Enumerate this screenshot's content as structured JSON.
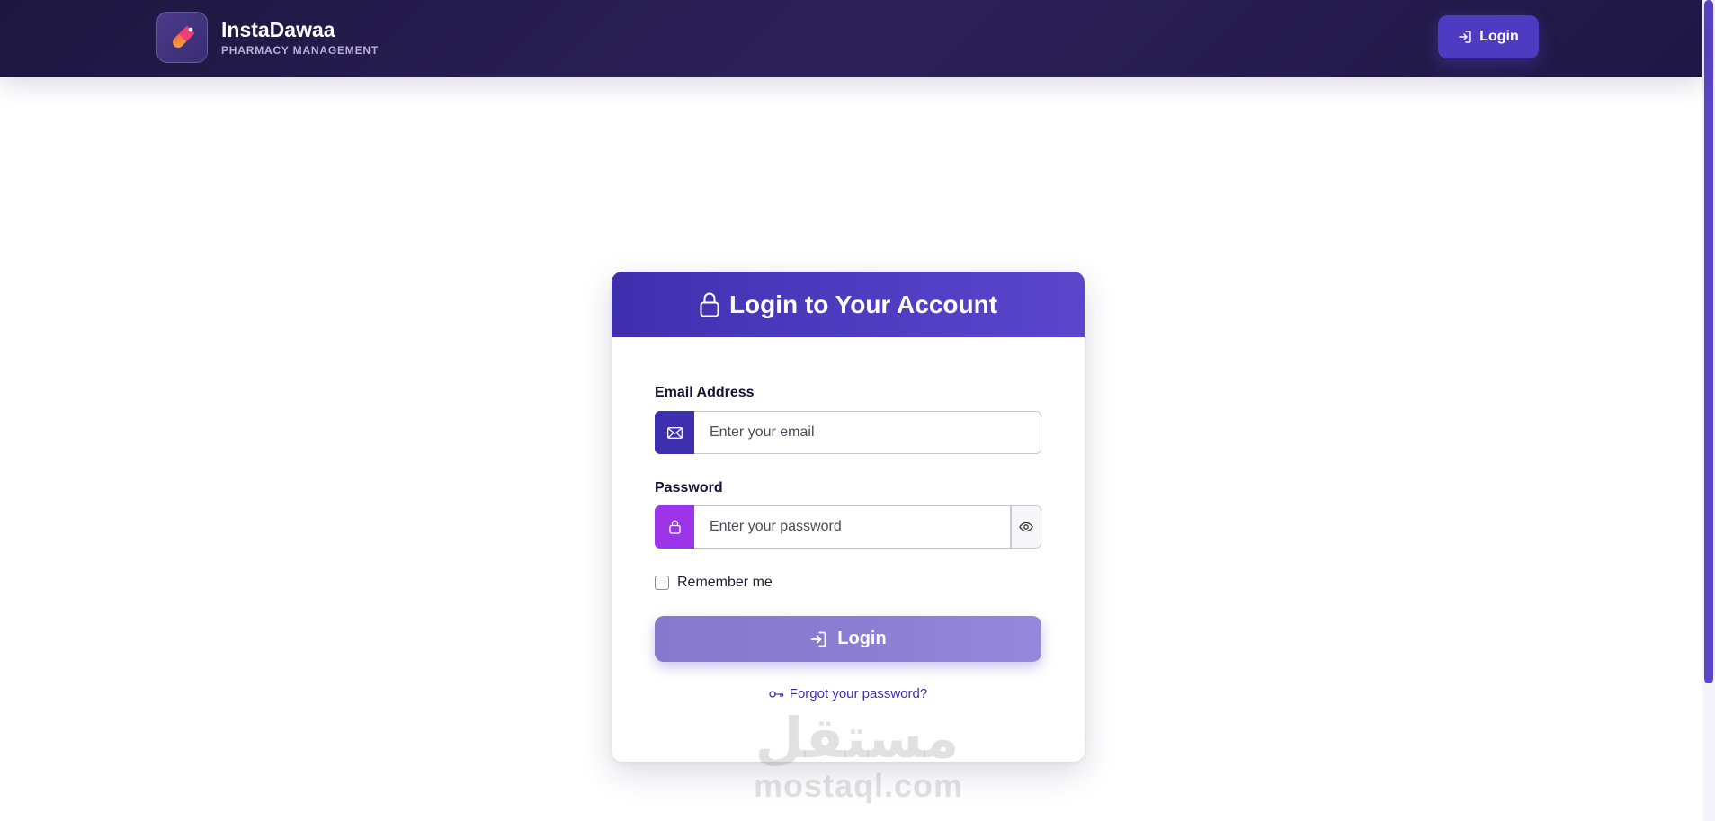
{
  "colors": {
    "navbar_bg": "#231b4b",
    "accent": "#4e3bc2",
    "email_addon": "#3e2fae",
    "password_addon": "#9c34ea",
    "login_button": "#8b7ed2",
    "link": "#3e2fae"
  },
  "header": {
    "logo_icon": "pill-icon",
    "brand_name": "InstaDawaa",
    "brand_tagline": "PHARMACY MANAGEMENT",
    "login_icon": "sign-in-icon",
    "login_label": "Login"
  },
  "login_card": {
    "title_icon": "lock-icon",
    "title": "Login to Your Account",
    "email": {
      "label": "Email Address",
      "icon": "envelope-icon",
      "placeholder": "Enter your email",
      "value": ""
    },
    "password": {
      "label": "Password",
      "icon": "lock-icon",
      "placeholder": "Enter your password",
      "value": "",
      "toggle_icon": "eye-icon"
    },
    "remember_me": {
      "label": "Remember me",
      "checked": false
    },
    "submit": {
      "icon": "sign-in-icon",
      "label": "Login"
    },
    "forgot_password": {
      "icon": "key-icon",
      "label": "Forgot your password?"
    }
  },
  "watermark": {
    "arabic": "مستقل",
    "latin": "mostaql.com"
  }
}
